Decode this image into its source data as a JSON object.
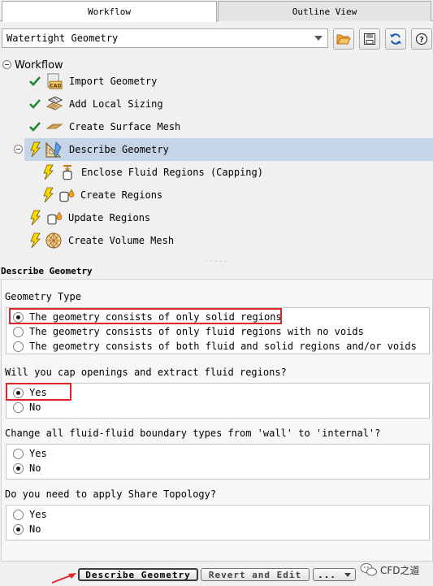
{
  "tabs": {
    "workflow": "Workflow",
    "outline": "Outline View"
  },
  "toolbar": {
    "workflow_type": "Watertight Geometry"
  },
  "tree": {
    "root": "Workflow",
    "items": [
      {
        "label": "Import Geometry"
      },
      {
        "label": "Add Local Sizing"
      },
      {
        "label": "Create Surface Mesh"
      },
      {
        "label": "Describe Geometry"
      },
      {
        "label": "Enclose Fluid Regions (Capping)"
      },
      {
        "label": "Create Regions"
      },
      {
        "label": "Update Regions"
      },
      {
        "label": "Create Volume Mesh"
      }
    ]
  },
  "panel": {
    "title": "Describe Geometry",
    "q1": {
      "label": "Geometry Type",
      "options": [
        "The geometry consists of only solid regions",
        "The geometry consists of only fluid regions with no voids",
        "The geometry consists of both fluid and solid regions and/or voids"
      ],
      "selected": 0
    },
    "q2": {
      "label": "Will you cap openings and extract fluid regions?",
      "options": [
        "Yes",
        "No"
      ],
      "selected": 0
    },
    "q3": {
      "label": "Change all fluid-fluid boundary types from 'wall' to 'internal'?",
      "options": [
        "Yes",
        "No"
      ],
      "selected": 1
    },
    "q4": {
      "label": "Do you need to apply Share Topology?",
      "options": [
        "Yes",
        "No"
      ],
      "selected": 1
    }
  },
  "buttons": {
    "describe": "Describe Geometry",
    "revert": "Revert and Edit",
    "more": "..."
  },
  "watermark": {
    "text": "CFD之道"
  },
  "colors": {
    "highlight": "#e0242a",
    "selection": "#c5d4e6",
    "check": "#1a8a2a",
    "bolt": "#ffd800"
  },
  "icons": [
    "open-folder-icon",
    "save-icon",
    "refresh-icon",
    "help-icon",
    "check-icon",
    "lightning-icon",
    "cad-icon",
    "sizing-icon",
    "surface-mesh-icon",
    "describe-geometry-icon",
    "capping-icon",
    "regions-icon",
    "volume-mesh-icon",
    "arrow-icon",
    "wechat-icon"
  ]
}
